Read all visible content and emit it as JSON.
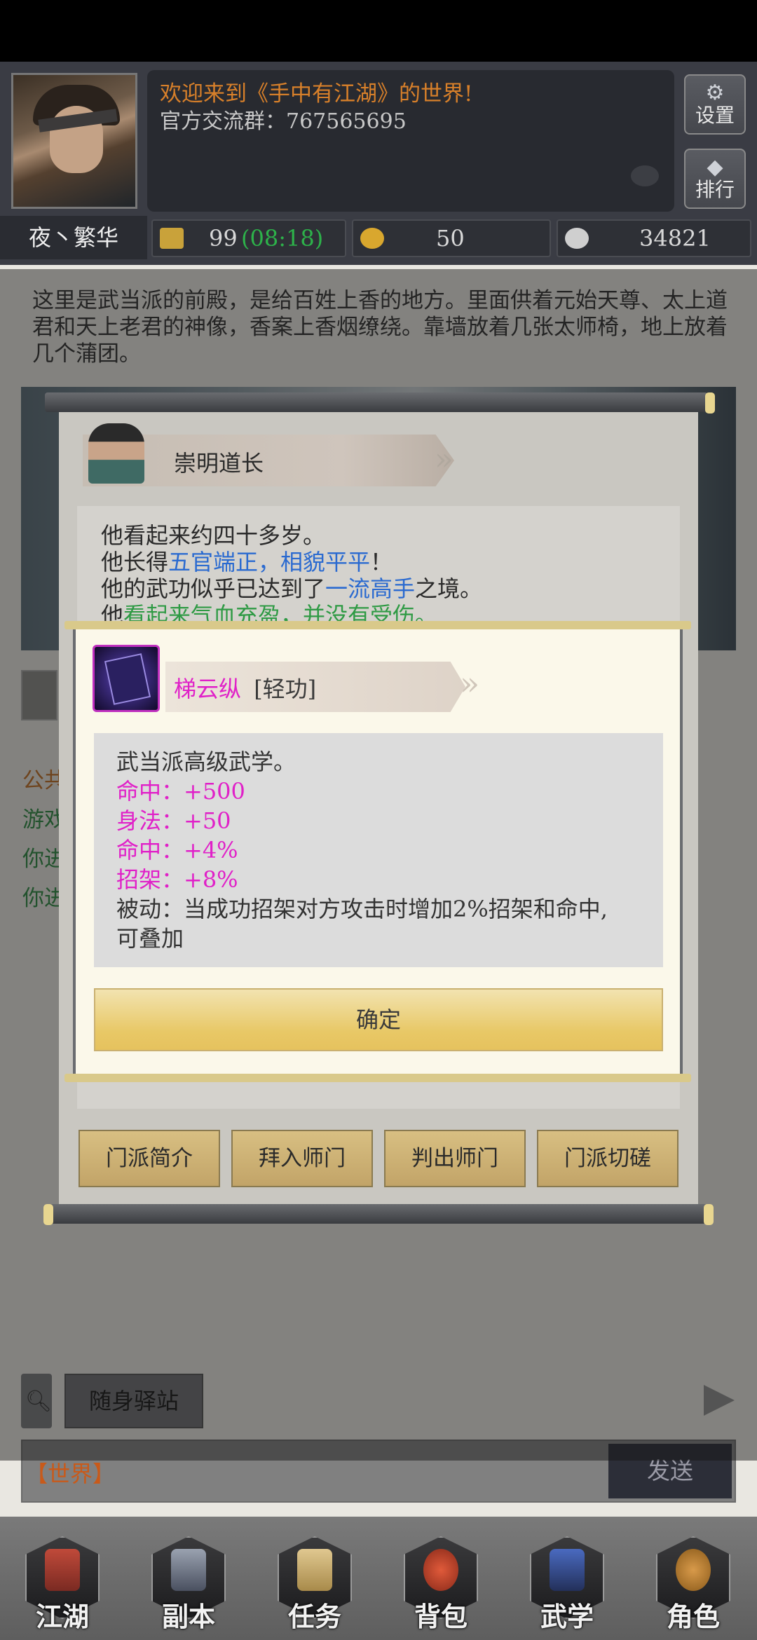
{
  "header": {
    "welcome": "欢迎来到《手中有江湖》的世界!",
    "group": "官方交流群：767565695",
    "settings_label": "设置",
    "rank_label": "排行",
    "player_name": "夜丶繁华",
    "stamina": "99",
    "stamina_timer": "(08:18)",
    "gold": "50",
    "silver": "34821",
    "colors": {
      "welcome": "#d8802a",
      "timer": "#2db24a"
    }
  },
  "scene": {
    "description": "这里是武当派的前殿，是给百姓上香的地方。里面供着元始天尊、太上道君和天上老君的神像，香案上香烟缭绕。靠墙放着几张太师椅，地上放着几个蒲团。"
  },
  "background_log": {
    "lines": [
      "公共",
      "游戏",
      "你进",
      "你进"
    ]
  },
  "npc": {
    "name": "崇明道长",
    "line1": "他看起来约四十多岁。",
    "line2_prefix": "他长得",
    "line2_highlight": "五官端正，相貌平平",
    "line2_suffix": "！",
    "line3_prefix": "他的武功似乎已达到了",
    "line3_highlight": "一流高手",
    "line3_suffix": "之境。",
    "line4_prefix": "他",
    "line4_highlight": "看起来气血充盈，并没有受伤。",
    "buttons": [
      "门派简介",
      "拜入师门",
      "判出师门",
      "门派切磋"
    ]
  },
  "skill_modal": {
    "name": "梯云纵",
    "type": "[轻功]",
    "intro": "武当派高级武学。",
    "stats": [
      "命中：+500",
      "身法：+50",
      "命中：+4%",
      "招架：+8%"
    ],
    "passive_line1": "被动：当成功招架对方攻击时增加2%招架和命中,",
    "passive_line2": "可叠加",
    "confirm_label": "确定",
    "colors": {
      "name": "#e020c8",
      "stat": "#e020c8"
    }
  },
  "chat": {
    "station_label": "随身驿站",
    "channel": "【世界】",
    "send_label": "发送"
  },
  "tabs": [
    "江湖",
    "副本",
    "任务",
    "背包",
    "武学",
    "角色"
  ]
}
